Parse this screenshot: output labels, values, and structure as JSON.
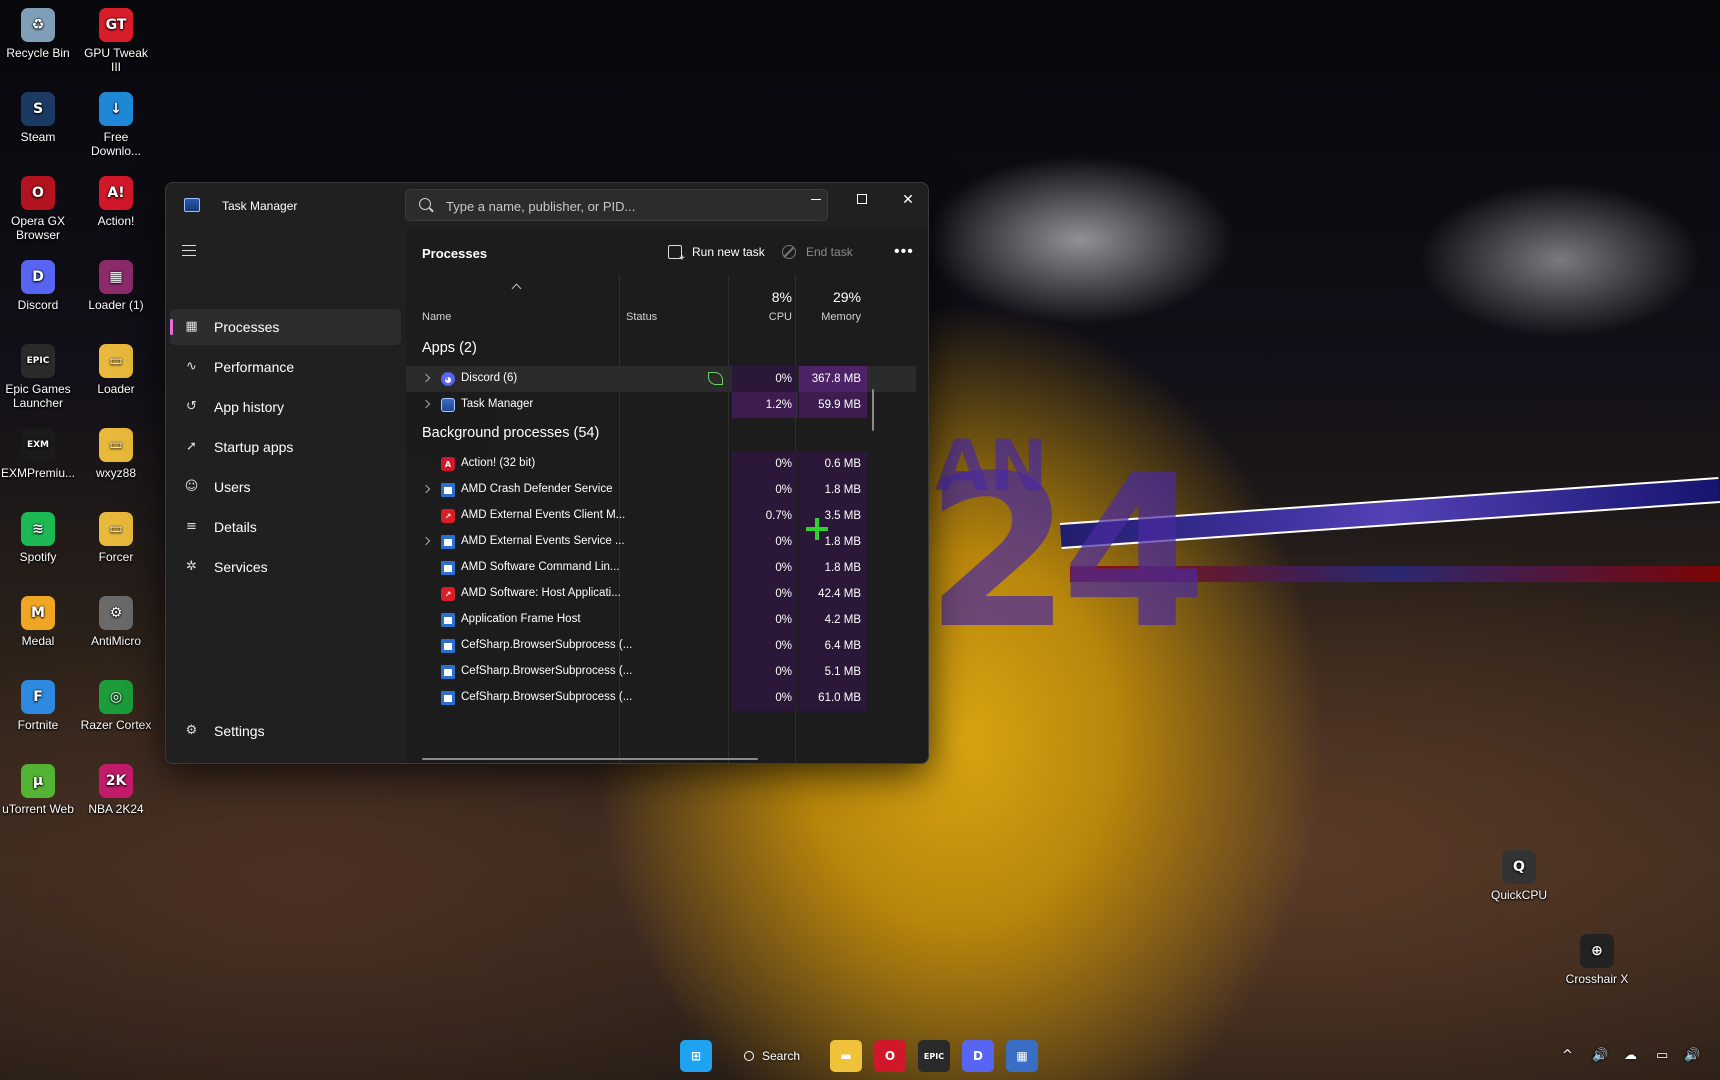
{
  "desktop": {
    "icons_left": [
      {
        "label": "Recycle Bin",
        "icon": "recycle-bin-icon",
        "color": "#7f9fb8",
        "glyph": "♻"
      },
      {
        "label": "GPU Tweak III",
        "icon": "gpu-tweak-icon",
        "color": "#d81c2a",
        "glyph": "GT"
      },
      {
        "label": "Steam",
        "icon": "steam-icon",
        "color": "#1b3a63",
        "glyph": "S"
      },
      {
        "label": "Free Downlo...",
        "icon": "free-download-manager-icon",
        "color": "#1e88d6",
        "glyph": "↓"
      },
      {
        "label": "Opera GX Browser",
        "icon": "opera-gx-icon",
        "color": "#b3121f",
        "glyph": "O"
      },
      {
        "label": "Action!",
        "icon": "action-icon",
        "color": "#d0182a",
        "glyph": "A!"
      },
      {
        "label": "Discord",
        "icon": "discord-icon",
        "color": "#5865f2",
        "glyph": "D"
      },
      {
        "label": "Loader (1)",
        "icon": "winrar-icon",
        "color": "#8c2a6a",
        "glyph": "▦"
      },
      {
        "label": "Epic Games Launcher",
        "icon": "epic-games-icon",
        "color": "#2a2a2a",
        "glyph": "EPIC"
      },
      {
        "label": "Loader",
        "icon": "folder-icon",
        "color": "#e8b93a",
        "glyph": "▭"
      },
      {
        "label": "EXMPremiu...",
        "icon": "exm-tweaks-icon",
        "color": "#1a1a1a",
        "glyph": "EXM"
      },
      {
        "label": "wxyz88",
        "icon": "folder-icon",
        "color": "#e8b93a",
        "glyph": "▭"
      },
      {
        "label": "Spotify",
        "icon": "spotify-icon",
        "color": "#1db954",
        "glyph": "≋"
      },
      {
        "label": "Forcer",
        "icon": "folder-icon",
        "color": "#e8b93a",
        "glyph": "▭"
      },
      {
        "label": "Medal",
        "icon": "medal-icon",
        "color": "#f0a623",
        "glyph": "M"
      },
      {
        "label": "AntiMicro",
        "icon": "antimicro-icon",
        "color": "#6a6a6a",
        "glyph": "⚙"
      },
      {
        "label": "Fortnite",
        "icon": "fortnite-icon",
        "color": "#2d8ae0",
        "glyph": "F"
      },
      {
        "label": "Razer Cortex",
        "icon": "razer-cortex-icon",
        "color": "#1c9c3a",
        "glyph": "◎"
      },
      {
        "label": "uTorrent Web",
        "icon": "utorrent-icon",
        "color": "#53b335",
        "glyph": "µ"
      },
      {
        "label": "NBA 2K24",
        "icon": "nba2k24-icon",
        "color": "#c21b6a",
        "glyph": "2K"
      }
    ],
    "icons_right": [
      {
        "label": "QuickCPU",
        "icon": "quickcpu-icon",
        "color": "#333333",
        "glyph": "Q"
      },
      {
        "label": "Crosshair X",
        "icon": "crosshair-x-icon",
        "color": "#222222",
        "glyph": "⊕"
      }
    ]
  },
  "window": {
    "title": "Task Manager",
    "search_placeholder": "Type a name, publisher, or PID..."
  },
  "sidebar": {
    "items": [
      {
        "label": "Processes",
        "icon": "processes-icon",
        "glyph": "▦",
        "active": true
      },
      {
        "label": "Performance",
        "icon": "performance-icon",
        "glyph": "∿",
        "active": false
      },
      {
        "label": "App history",
        "icon": "app-history-icon",
        "glyph": "↺",
        "active": false
      },
      {
        "label": "Startup apps",
        "icon": "startup-apps-icon",
        "glyph": "➚",
        "active": false
      },
      {
        "label": "Users",
        "icon": "users-icon",
        "glyph": "☺",
        "active": false
      },
      {
        "label": "Details",
        "icon": "details-icon",
        "glyph": "≡",
        "active": false
      },
      {
        "label": "Services",
        "icon": "services-icon",
        "glyph": "✲",
        "active": false
      }
    ],
    "settings_label": "Settings"
  },
  "main": {
    "page_title": "Processes",
    "run_new_task_label": "Run new task",
    "end_task_label": "End task",
    "more_label": "•••",
    "columns": {
      "name": "Name",
      "status": "Status",
      "cpu_percent": "8%",
      "cpu": "CPU",
      "memory_percent": "29%",
      "memory": "Memory"
    },
    "apps_group": "Apps (2)",
    "apps": [
      {
        "name": "Discord (6)",
        "icon": "discord",
        "expandable": true,
        "efficiency": true,
        "cpu": "0%",
        "memory": "367.8 MB",
        "cpu_heat": 0,
        "mem_heat": 2,
        "selected": true
      },
      {
        "name": "Task Manager",
        "icon": "tm",
        "expandable": true,
        "efficiency": false,
        "cpu": "1.2%",
        "memory": "59.9 MB",
        "cpu_heat": 1,
        "mem_heat": 1,
        "selected": false
      }
    ],
    "background_group": "Background processes (54)",
    "background": [
      {
        "name": "Action! (32 bit)",
        "icon": "action",
        "expandable": false,
        "cpu": "0%",
        "memory": "0.6 MB"
      },
      {
        "name": "AMD Crash Defender Service",
        "icon": "win",
        "expandable": true,
        "cpu": "0%",
        "memory": "1.8 MB"
      },
      {
        "name": "AMD External Events Client M...",
        "icon": "amd",
        "expandable": false,
        "cpu": "0.7%",
        "memory": "3.5 MB"
      },
      {
        "name": "AMD External Events Service ...",
        "icon": "win",
        "expandable": true,
        "cpu": "0%",
        "memory": "1.8 MB"
      },
      {
        "name": "AMD Software Command Lin...",
        "icon": "win",
        "expandable": false,
        "cpu": "0%",
        "memory": "1.8 MB"
      },
      {
        "name": "AMD Software: Host Applicati...",
        "icon": "amd",
        "expandable": false,
        "cpu": "0%",
        "memory": "42.4 MB"
      },
      {
        "name": "Application Frame Host",
        "icon": "win",
        "expandable": false,
        "cpu": "0%",
        "memory": "4.2 MB"
      },
      {
        "name": "CefSharp.BrowserSubprocess (...",
        "icon": "win",
        "expandable": false,
        "cpu": "0%",
        "memory": "6.4 MB"
      },
      {
        "name": "CefSharp.BrowserSubprocess (...",
        "icon": "win",
        "expandable": false,
        "cpu": "0%",
        "memory": "5.1 MB"
      },
      {
        "name": "CefSharp.BrowserSubprocess (...",
        "icon": "win",
        "expandable": false,
        "cpu": "0%",
        "memory": "61.0 MB"
      }
    ]
  },
  "taskbar": {
    "search_label": "Search",
    "apps": [
      {
        "icon": "windows-start-icon",
        "glyph": "⊞",
        "color": "#1fa3f0"
      },
      {
        "icon": "file-explorer-icon",
        "glyph": "▬",
        "color": "#f0c23a"
      },
      {
        "icon": "opera-gx-icon",
        "glyph": "O",
        "color": "#d0182a"
      },
      {
        "icon": "epic-games-icon",
        "glyph": "EPIC",
        "color": "#2a2a2a"
      },
      {
        "icon": "discord-icon",
        "glyph": "D",
        "color": "#5865f2"
      },
      {
        "icon": "task-manager-icon",
        "glyph": "▦",
        "color": "#3a6dc4"
      }
    ],
    "tray": [
      {
        "icon": "chevron-up-icon",
        "glyph": "^"
      },
      {
        "icon": "volume-icon",
        "glyph": "🔊"
      },
      {
        "icon": "onedrive-icon",
        "glyph": "☁"
      },
      {
        "icon": "network-icon",
        "glyph": "▭"
      },
      {
        "icon": "speaker-icon",
        "glyph": "🔊"
      }
    ]
  }
}
